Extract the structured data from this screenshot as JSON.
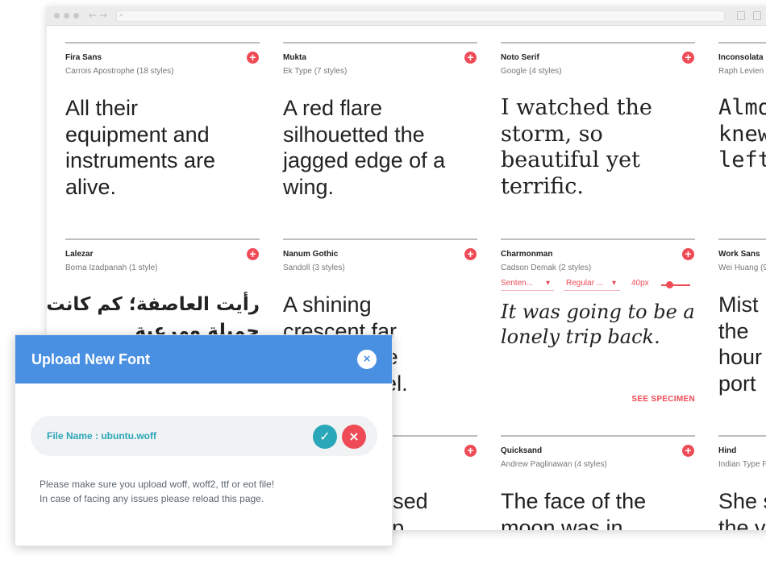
{
  "browser": {
    "nav_back": "←",
    "nav_forward": "→",
    "search_icon": "⌕"
  },
  "fonts": [
    {
      "name": "Fira Sans",
      "author": "Carrois Apostrophe (18 styles)",
      "sample": [
        "All their",
        "equipment and",
        "instruments are",
        "alive."
      ]
    },
    {
      "name": "Mukta",
      "author": "Ek Type (7 styles)",
      "sample": [
        "A red flare",
        "silhouetted the",
        "jagged edge of a",
        "wing."
      ]
    },
    {
      "name": "Noto Serif",
      "author": "Google (4 styles)",
      "sample": [
        "I watched the",
        "storm, so",
        "beautiful yet",
        "terrific."
      ]
    },
    {
      "name": "Inconsolata",
      "author": "Raph Levien",
      "sample": [
        "Almo",
        "knew",
        "left"
      ]
    },
    {
      "name": "Lalezar",
      "author": "Borna Izadpanah (1 style)",
      "sample": [
        "رأيت العاصفة؛ كم كانت",
        "جميلة ومرعبة"
      ]
    },
    {
      "name": "Nanum Gothic",
      "author": "Sandoll (3 styles)",
      "sample": [
        "A shining",
        "crescent far",
        "beneath the",
        "flying vessel."
      ]
    },
    {
      "name": "Charmonman",
      "author": "Cadson Demak (2 styles)",
      "sample": [
        "It was going to be a",
        "lonely trip back."
      ]
    },
    {
      "name": "Work Sans",
      "author": "Wei Huang (9",
      "sample": [
        "Mist",
        "the",
        "hour",
        "port"
      ]
    },
    {
      "name": "",
      "author": "",
      "sample": [
        "It was suffused",
        "with the ship"
      ]
    },
    {
      "name": "Quicksand",
      "author": "Andrew Paglinawan (4 styles)",
      "sample": [
        "The face of the",
        "moon was in"
      ]
    },
    {
      "name": "Hind",
      "author": "Indian Type F",
      "sample": [
        "She s",
        "the v"
      ]
    }
  ],
  "controls": {
    "sentence_label": "Senten...",
    "style_label": "Regular ...",
    "size_label": "40px",
    "size_value": 40,
    "see_specimen": "SEE SPECIMEN"
  },
  "add_symbol": "+",
  "dialog": {
    "title": "Upload New Font",
    "close_symbol": "×",
    "file_name": "File Name : ubuntu.woff",
    "confirm_symbol": "✓",
    "cancel_symbol": "×",
    "note_line1": "Please make sure you upload woff, woff2, ttf or eot file!",
    "note_line2": "In case of facing any issues please reload this page."
  },
  "colors": {
    "accent_red": "#ef4b56",
    "dialog_blue": "#4a90e2",
    "teal": "#2aa7b8"
  }
}
